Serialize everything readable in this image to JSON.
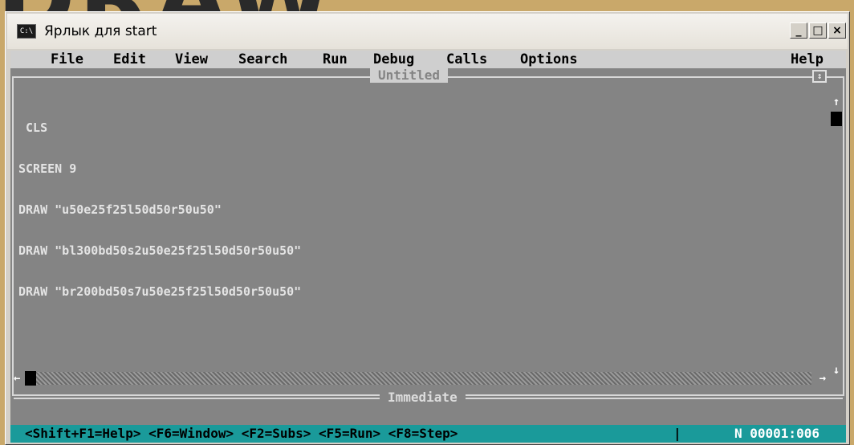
{
  "background_word": "DRAW",
  "window": {
    "icon_text": "C:\\",
    "title": "Ярлык для start",
    "minimize": "_",
    "maximize": "□",
    "close": "×"
  },
  "menu": {
    "items": [
      "File",
      "Edit",
      "View",
      "Search",
      "Run",
      "Debug",
      "Calls",
      "Options"
    ],
    "help": "Help"
  },
  "editor": {
    "title": "Untitled",
    "code_lines": [
      " CLS",
      "SCREEN 9",
      "DRAW \"u50e25f25l50d50r50u50\"",
      "DRAW \"bl300bd50s2u50e25f25l50d50r50u50\"",
      "DRAW \"br200bd50s7u50e25f25l50d50r50u50\""
    ],
    "maxbox_glyph": "↕",
    "scroll_up": "↑",
    "scroll_down": "↓",
    "scroll_left": "←",
    "scroll_right": "→"
  },
  "immediate": {
    "title": "Immediate"
  },
  "status": {
    "hint": "<Shift+F1=Help> <F6=Window> <F2=Subs> <F5=Run> <F8=Step>",
    "separator": "|",
    "position": "N 00001:006"
  },
  "colors": {
    "dos_background": "#848484",
    "status_bar": "#1a9a9a",
    "menu_bar": "#cfcfcf"
  }
}
